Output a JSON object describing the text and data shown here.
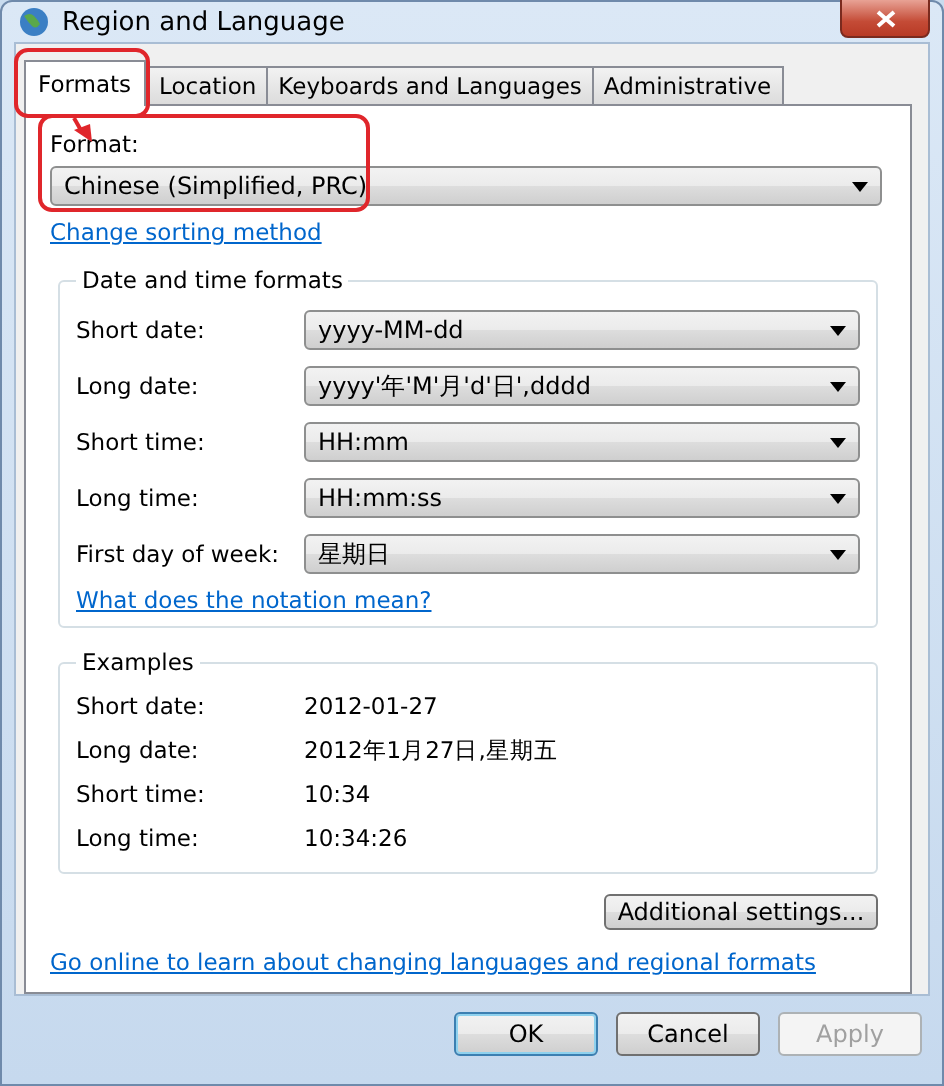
{
  "window": {
    "title": "Region and Language"
  },
  "tabs": [
    {
      "label": "Formats",
      "selected": true,
      "highlighted": true
    },
    {
      "label": "Location",
      "selected": false,
      "highlighted": false
    },
    {
      "label": "Keyboards and Languages",
      "selected": false,
      "highlighted": false
    },
    {
      "label": "Administrative",
      "selected": false,
      "highlighted": false
    }
  ],
  "format": {
    "label": "Format:",
    "value": "Chinese (Simplified, PRC)",
    "highlighted": true
  },
  "annotation_arrow": true,
  "sorting_link": "Change sorting method",
  "date_time_formats": {
    "title": "Date and time formats",
    "rows": [
      {
        "label": "Short date:",
        "value": "yyyy-MM-dd"
      },
      {
        "label": "Long date:",
        "value": "yyyy'年'M'月'd'日',dddd"
      },
      {
        "label": "Short time:",
        "value": "HH:mm"
      },
      {
        "label": "Long time:",
        "value": "HH:mm:ss"
      },
      {
        "label": "First day of week:",
        "value": "星期日"
      }
    ],
    "link": "What does the notation mean?"
  },
  "examples": {
    "title": "Examples",
    "rows": [
      {
        "label": "Short date:",
        "value": "2012-01-27"
      },
      {
        "label": "Long date:",
        "value": "2012年1月27日,星期五"
      },
      {
        "label": "Short time:",
        "value": "10:34"
      },
      {
        "label": "Long time:",
        "value": "10:34:26"
      }
    ]
  },
  "additional_button": "Additional settings...",
  "online_link": "Go online to learn about changing languages and regional formats",
  "buttons": [
    {
      "label": "OK",
      "kind": "default",
      "disabled": false
    },
    {
      "label": "Cancel",
      "kind": "normal",
      "disabled": false
    },
    {
      "label": "Apply",
      "kind": "normal",
      "disabled": true
    }
  ]
}
